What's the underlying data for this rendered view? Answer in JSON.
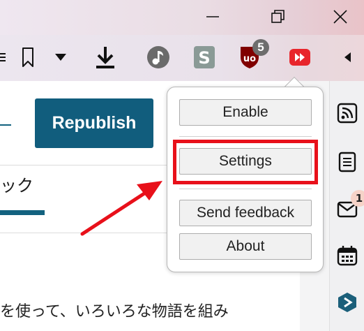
{
  "window": {
    "minimize_icon": "minimize-icon",
    "maximize_icon": "restore-icon",
    "close_icon": "close-icon"
  },
  "toolbar": {
    "icons": [
      "menu-icon",
      "bookmark-icon",
      "dropdown-icon",
      "download-icon",
      "music-extension-icon",
      "s-extension-icon",
      "ublock-icon",
      "skip-extension-icon",
      "back-arrow-icon"
    ],
    "ublock_badge": "5",
    "ublock_letter": "uo",
    "s_letter": "S"
  },
  "page": {
    "republish_label": "Republish",
    "tab_label": "ック",
    "body_text": "を使って、いろいろな物語を組み"
  },
  "popup": {
    "buttons": {
      "enable": "Enable",
      "settings": "Settings",
      "send_feedback": "Send feedback",
      "about": "About"
    },
    "highlight_color": "#e8101a"
  },
  "sidebar": {
    "icons": [
      "rss-icon",
      "notes-icon",
      "mail-icon",
      "calendar-icon",
      "extension-icon"
    ],
    "mail_badge": "1"
  },
  "colors": {
    "accent": "#115d7d",
    "annotation": "#e8101a"
  }
}
